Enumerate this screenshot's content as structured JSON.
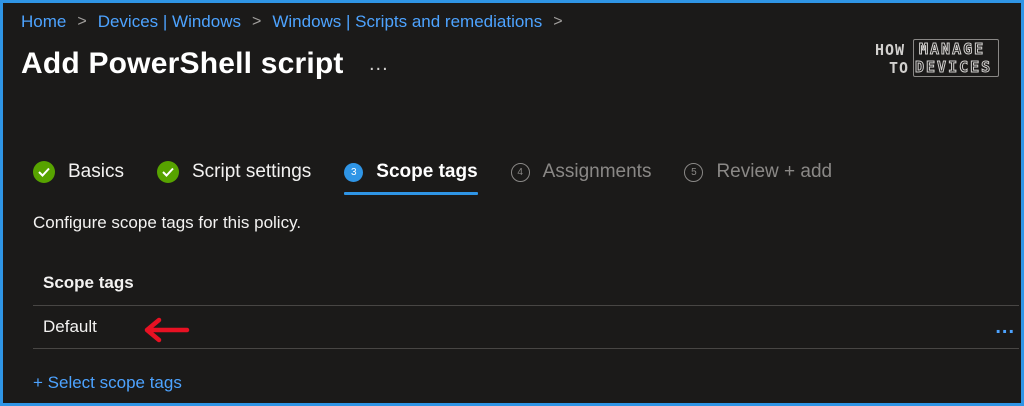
{
  "breadcrumb": {
    "items": [
      "Home",
      "Devices | Windows",
      "Windows | Scripts and remediations"
    ],
    "separator": ">"
  },
  "page": {
    "title": "Add PowerShell script",
    "more": "..."
  },
  "logo": {
    "how": "HOW",
    "to": "TO",
    "manage": "MANAGE",
    "devices": "DEVICES"
  },
  "tabs": [
    {
      "label": "Basics",
      "state": "completed",
      "icon": "check-icon"
    },
    {
      "label": "Script settings",
      "state": "completed",
      "icon": "check-icon"
    },
    {
      "label": "Scope tags",
      "state": "active",
      "number": "3"
    },
    {
      "label": "Assignments",
      "state": "disabled",
      "number": "4"
    },
    {
      "label": "Review + add",
      "state": "disabled",
      "number": "5"
    }
  ],
  "description": "Configure scope tags for this policy.",
  "table": {
    "header": "Scope tags",
    "rows": [
      {
        "name": "Default",
        "more": "..."
      }
    ]
  },
  "select_link": "+ Select scope tags",
  "colors": {
    "accent": "#2f95e6",
    "link": "#4da3ff",
    "success": "#57a300",
    "annotation_arrow": "#e81123",
    "background": "#1b1a19"
  }
}
